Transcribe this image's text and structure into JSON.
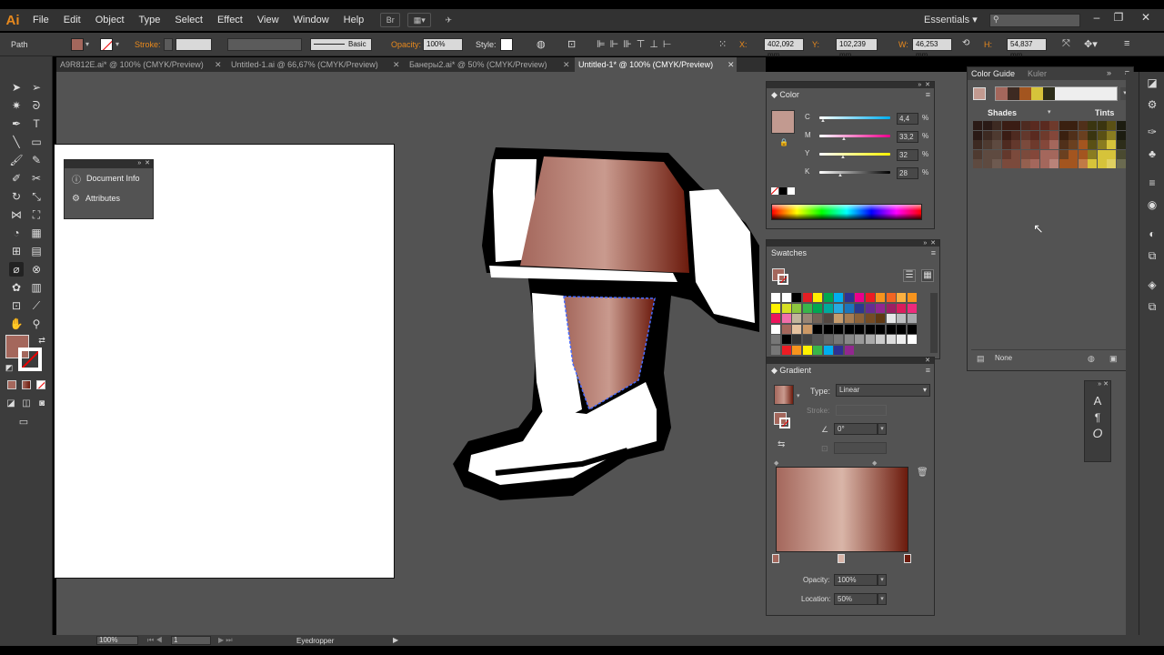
{
  "app": {
    "logo": "Ai"
  },
  "menu": [
    "File",
    "Edit",
    "Object",
    "Type",
    "Select",
    "Effect",
    "View",
    "Window",
    "Help"
  ],
  "menu_icons": {
    "bridge": "Br"
  },
  "workspace": "Essentials",
  "control": {
    "selection_label": "Path",
    "stroke_label": "Stroke:",
    "brush_style": "Basic",
    "opacity_label": "Opacity:",
    "opacity_value": "100%",
    "style_label": "Style:",
    "x_label": "X:",
    "x_value": "402,092 mm",
    "y_label": "Y:",
    "y_value": "102,239 mm",
    "w_label": "W:",
    "w_value": "46,253 mm",
    "h_label": "H:",
    "h_value": "54,837 mm"
  },
  "tabs": [
    {
      "label": "A9R812E.ai* @ 100% (CMYK/Preview)"
    },
    {
      "label": "Untitled-1.ai @ 66,67% (CMYK/Preview)"
    },
    {
      "label": "Банеры2.ai* @ 50% (CMYK/Preview)"
    },
    {
      "label": "Untitled-1* @ 100% (CMYK/Preview)"
    }
  ],
  "doc_panel": {
    "items": [
      {
        "label": "Document Info"
      },
      {
        "label": "Attributes"
      }
    ]
  },
  "color_panel": {
    "title": "Color",
    "channels": [
      {
        "name": "C",
        "value": "4,4",
        "unit": "%",
        "level": 0.04
      },
      {
        "name": "M",
        "value": "33,2",
        "unit": "%",
        "level": 0.33
      },
      {
        "name": "Y",
        "value": "32",
        "unit": "%",
        "level": 0.32
      },
      {
        "name": "K",
        "value": "28",
        "unit": "%",
        "level": 0.28
      }
    ]
  },
  "swatches_panel": {
    "title": "Swatches"
  },
  "gradient_panel": {
    "title": "Gradient",
    "type_label": "Type:",
    "type_value": "Linear",
    "stroke_label": "Stroke:",
    "angle_value": "0°",
    "opacity_label": "Opacity:",
    "opacity_value": "100%",
    "location_label": "Location:",
    "location_value": "50%",
    "colors": {
      "start": "#a4675c",
      "mid": "#d9b5a8",
      "end": "#6b1a0c"
    }
  },
  "color_guide_panel": {
    "tabs": [
      "Color Guide",
      "Kuler"
    ],
    "shades_label": "Shades",
    "tints_label": "Tints",
    "footer_label": "None"
  },
  "status": {
    "zoom": "100%",
    "page": "1",
    "tool": "Eyedropper"
  },
  "colors": {
    "accent": "#e8891d",
    "fill": "#a4675c",
    "path_selection": "#4a6cff"
  }
}
